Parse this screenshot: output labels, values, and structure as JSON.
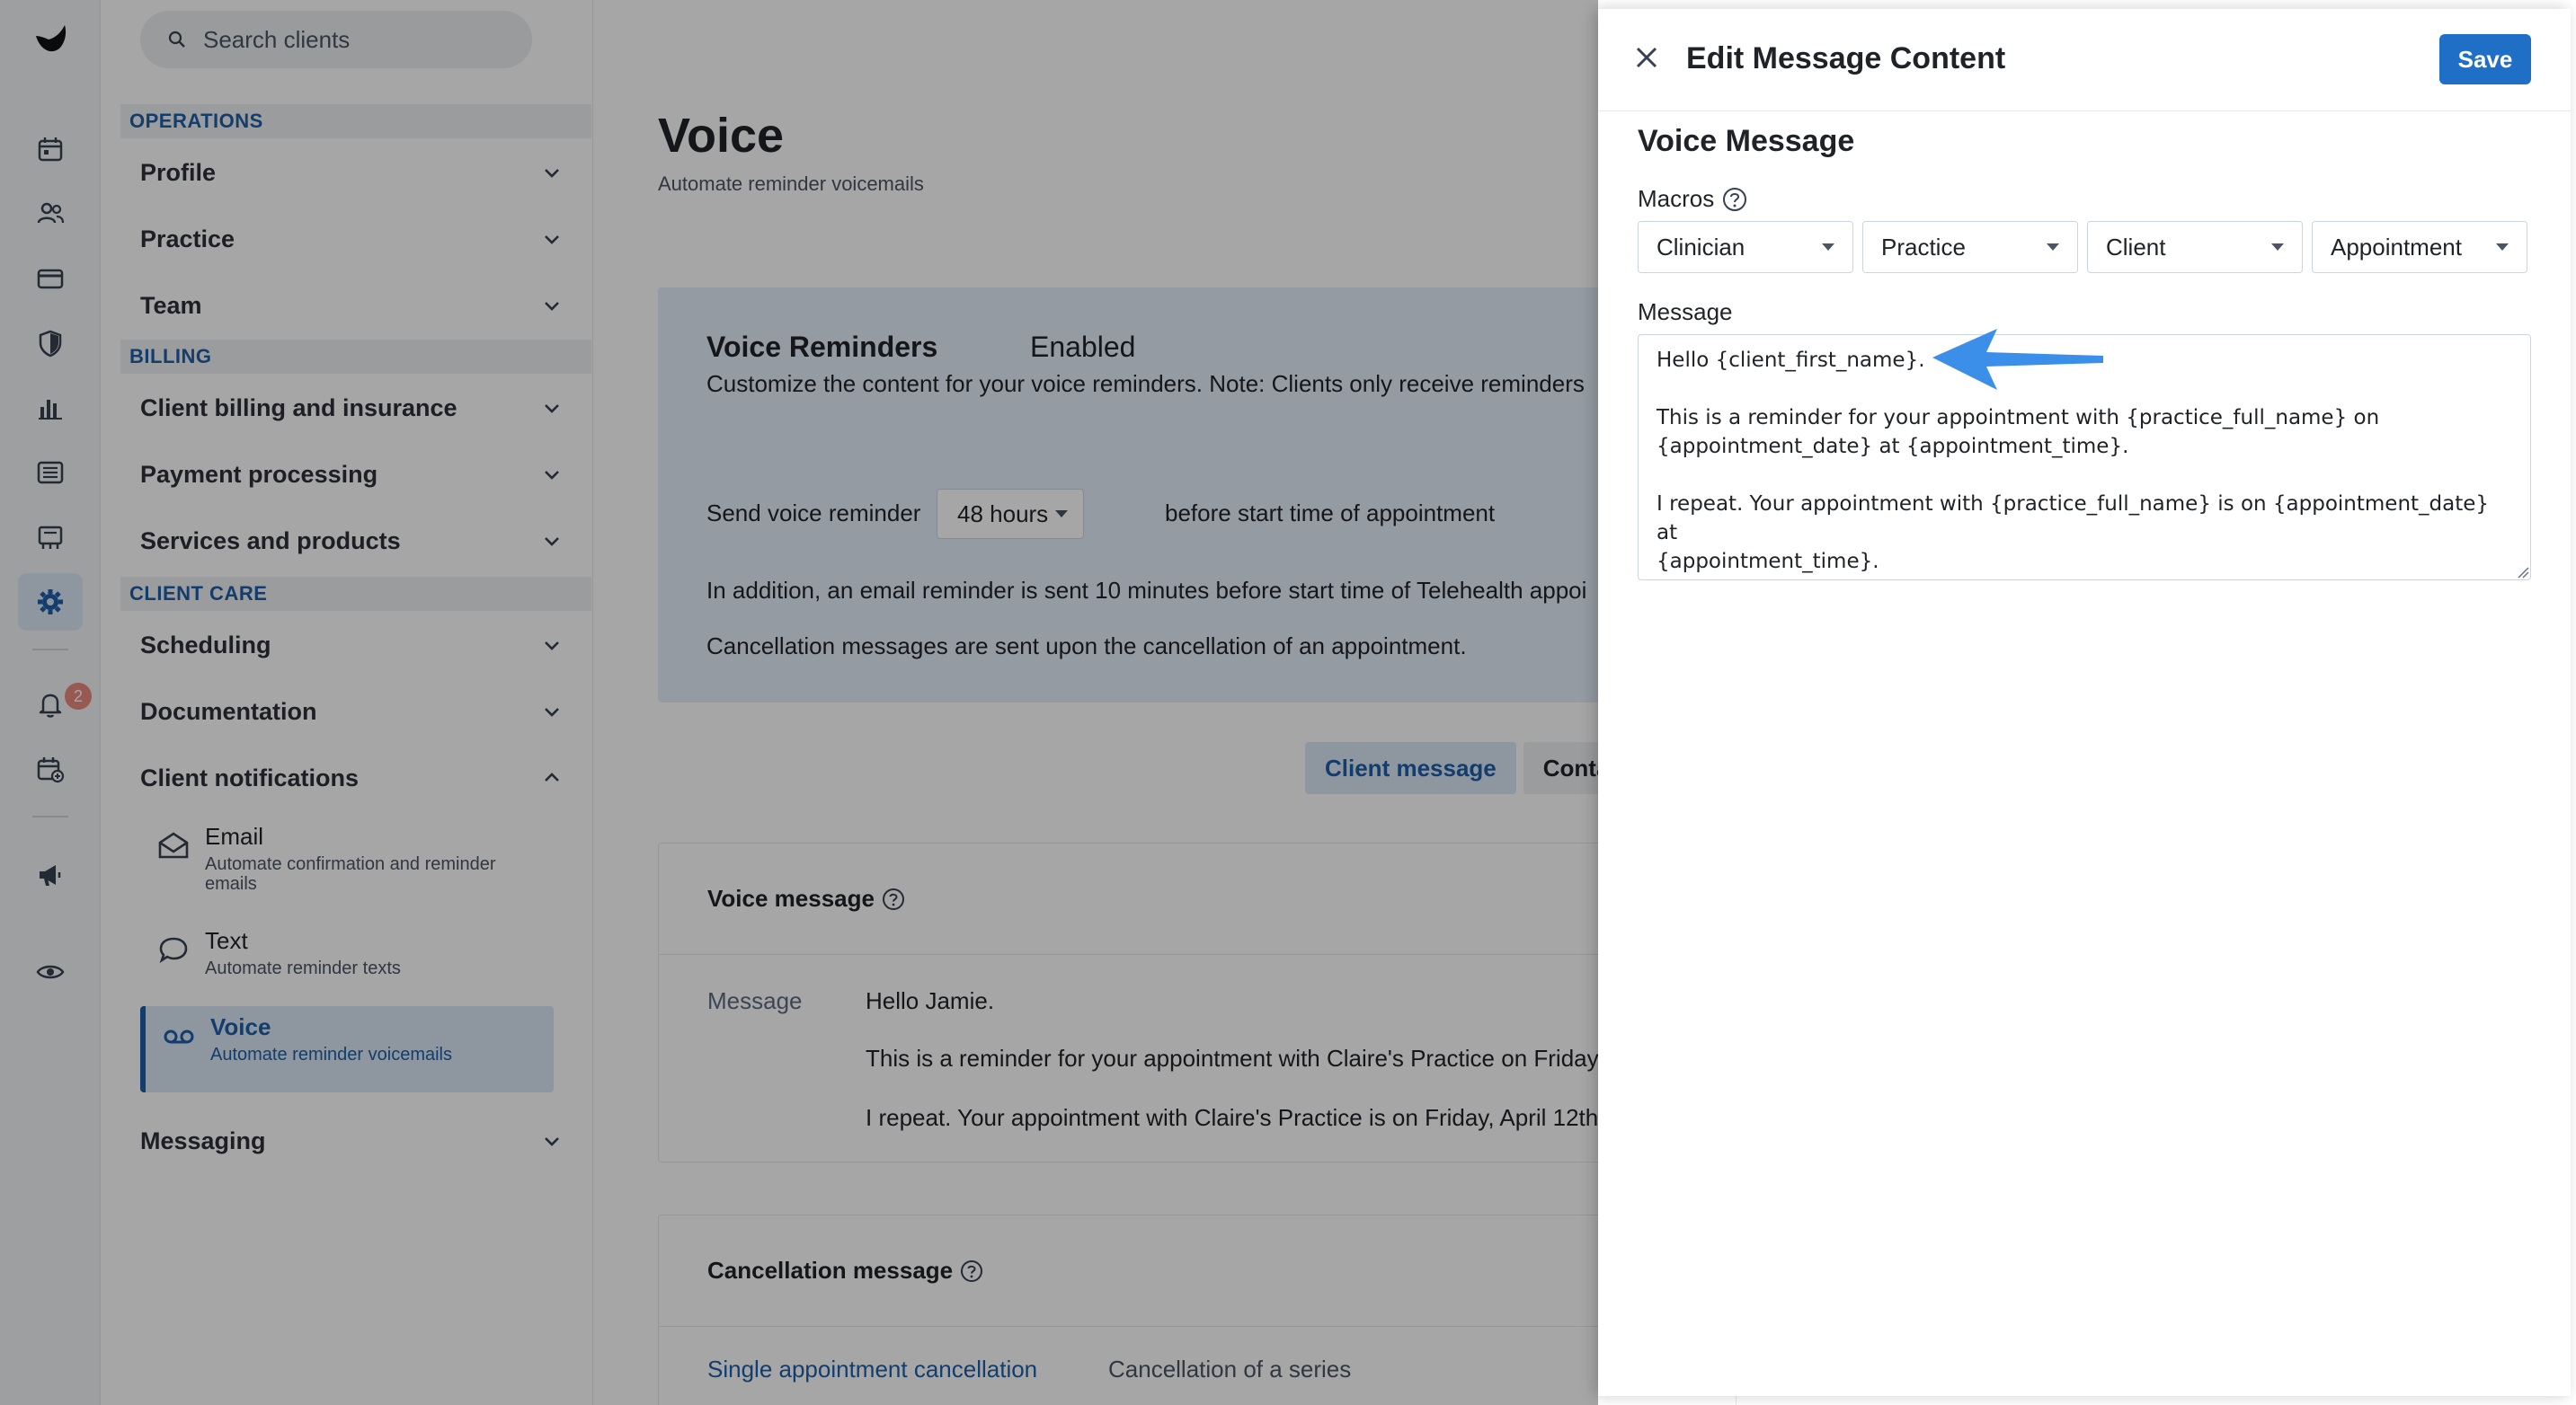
{
  "search": {
    "placeholder": "Search clients"
  },
  "rail": {
    "items": [
      {
        "icon": "calendar-icon"
      },
      {
        "icon": "clients-icon"
      },
      {
        "icon": "card-icon"
      },
      {
        "icon": "shield-icon"
      },
      {
        "icon": "analytics-icon"
      },
      {
        "icon": "list-icon"
      },
      {
        "icon": "marketplace-icon"
      },
      {
        "icon": "settings-icon"
      },
      {
        "icon": "bell-icon",
        "badge": "2"
      },
      {
        "icon": "calendar-add-icon"
      },
      {
        "icon": "megaphone-icon"
      },
      {
        "icon": "eye-icon"
      }
    ]
  },
  "sidebar": {
    "sections": [
      {
        "title": "OPERATIONS",
        "items": [
          "Profile",
          "Practice",
          "Team"
        ]
      },
      {
        "title": "BILLING",
        "items": [
          "Client billing and insurance",
          "Payment processing",
          "Services and products"
        ]
      },
      {
        "title": "CLIENT CARE",
        "items": [
          "Scheduling",
          "Documentation",
          "Client notifications"
        ]
      }
    ],
    "notifications_sub": [
      {
        "label": "Email",
        "desc": "Automate confirmation and reminder emails"
      },
      {
        "label": "Text",
        "desc": "Automate reminder texts"
      },
      {
        "label": "Voice",
        "desc": "Automate reminder voicemails"
      }
    ],
    "messaging": "Messaging"
  },
  "main": {
    "title": "Voice",
    "subtitle": "Automate reminder voicemails",
    "panel": {
      "title": "Voice Reminders",
      "status": "Enabled",
      "desc": "Customize the content for your voice reminders. Note: Clients only receive reminders",
      "send_label": "Send voice reminder",
      "send_value": "48 hours",
      "send_after": "before start time of appointment",
      "email_note": "In addition, an email reminder is sent 10 minutes before start time of Telehealth appoi",
      "cancel_note": "Cancellation messages are sent upon the cancellation of an appointment."
    },
    "tabs": [
      "Client message",
      "Conta"
    ],
    "voice_card": {
      "title": "Voice message",
      "message_label": "Message",
      "lines": [
        "Hello Jamie.",
        "This is a reminder for your appointment with Claire's Practice on Friday",
        "I repeat. Your appointment with Claire's Practice is on Friday, April 12th"
      ]
    },
    "cancel_card": {
      "title": "Cancellation message",
      "tabs": [
        "Single appointment cancellation",
        "Cancellation of a series"
      ]
    }
  },
  "drawer": {
    "title": "Edit Message Content",
    "save_label": "Save",
    "section_title": "Voice Message",
    "macros_label": "Macros",
    "macros": [
      "Clinician",
      "Practice",
      "Client",
      "Appointment"
    ],
    "message_label": "Message",
    "message_value": "Hello {client_first_name}.\n\nThis is a reminder for your appointment with {practice_full_name} on\n{appointment_date} at {appointment_time}.\n\nI repeat. Your appointment with {practice_full_name} is on {appointment_date} at\n{appointment_time}."
  },
  "colors": {
    "accent": "#1f6fc7",
    "arrow": "#3b8fe8",
    "badge": "#e8897e"
  }
}
